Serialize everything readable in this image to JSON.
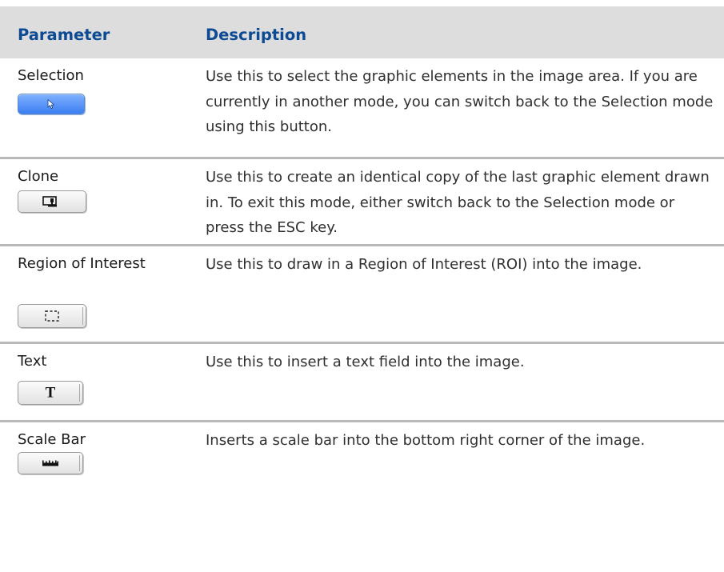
{
  "header": {
    "parameter": "Parameter",
    "description": "Description"
  },
  "rows": [
    {
      "parameter": "Selection",
      "description": "Use this to select the graphic elements in the image area. If you are currently in another mode, you can switch back to the Selection mode using this button.",
      "button_icon": "arrow-cursor-icon",
      "button_active": true
    },
    {
      "parameter": "Clone",
      "description": "Use this to create an identical copy of the last graphic element drawn in. To exit this mode, either switch back to the Selection mode or press the ESC key.",
      "button_icon": "clone-stamp-icon"
    },
    {
      "parameter": "Region of Interest",
      "description": "Use this to draw in a Region of Interest (ROI) into the image.",
      "button_icon": "dashed-rectangle-icon"
    },
    {
      "parameter": "Text",
      "description": "Use this to insert a text field into the image.",
      "button_icon": "text-t-icon",
      "button_glyph": "T"
    },
    {
      "parameter": "Scale Bar",
      "description": "Inserts a scale bar into the bottom right corner of the image.",
      "button_icon": "ruler-scale-bar-icon"
    }
  ],
  "colors": {
    "header_background": "#dddddd",
    "header_text": "#0c4a94",
    "row_divider": "#b9b9b9",
    "active_button": "#3b7ff2"
  }
}
